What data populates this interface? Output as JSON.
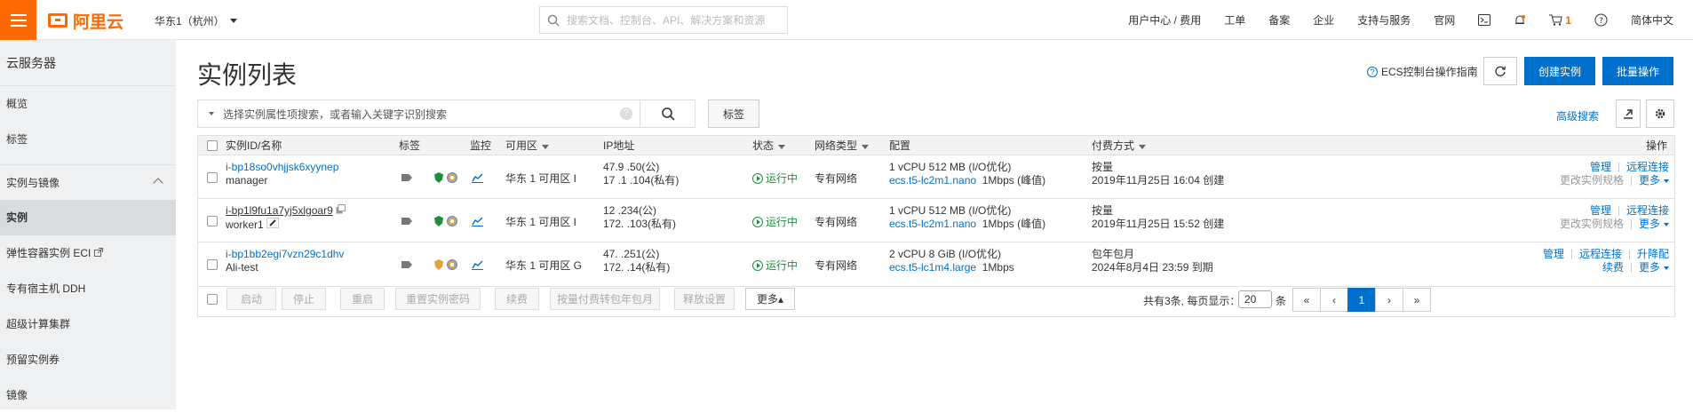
{
  "header": {
    "logo": "阿里云",
    "region": "华东1（杭州）",
    "search_placeholder": "搜索文档、控制台、API、解决方案和资源",
    "nav": [
      "用户中心 / 费用",
      "工单",
      "备案",
      "企业",
      "支持与服务",
      "官网"
    ],
    "cart_count": "1",
    "language": "简体中文"
  },
  "sidebar": {
    "title": "云服务器",
    "items": [
      {
        "label": "概览"
      },
      {
        "label": "标签"
      }
    ],
    "section": "实例与镜像",
    "sub_items": [
      {
        "label": "实例",
        "active": true
      },
      {
        "label": "弹性容器实例 ECI"
      },
      {
        "label": "专有宿主机 DDH"
      },
      {
        "label": "超级计算集群"
      },
      {
        "label": "预留实例券"
      },
      {
        "label": "镜像"
      }
    ]
  },
  "page": {
    "title": "实例列表",
    "guide": "ECS控制台操作指南",
    "create_button": "创建实例",
    "batch_button": "批量操作",
    "filter_placeholder": "选择实例属性项搜索，或者输入关键字识别搜索",
    "tag_button": "标签",
    "advanced_search": "高级搜索"
  },
  "table": {
    "columns": [
      "实例ID/名称",
      "标签",
      "监控",
      "可用区",
      "IP地址",
      "状态",
      "网络类型",
      "配置",
      "付费方式",
      "操作"
    ],
    "rows": [
      {
        "id": "i-bp18so0vhjjsk6xyynep",
        "name": "manager",
        "zone": "华东 1 可用区 I",
        "ip_public": "47.9    .50(公)",
        "ip_private": "17 .1    .104(私有)",
        "status": "运行中",
        "network": "专有网络",
        "config": "1 vCPU 512 MB (I/O优化)",
        "spec": "ecs.t5-lc2m1.nano",
        "bandwidth": "1Mbps (峰值)",
        "billing": "按量",
        "created": "2019年11月25日 16:04 创建",
        "ops_top": [
          "管理",
          "远程连接"
        ],
        "ops_bottom": "更改实例规格",
        "more": "更多"
      },
      {
        "id": "i-bp1l9fu1a7yj5xlgoar9",
        "name": "worker1",
        "zone": "华东 1 可用区 I",
        "ip_public": "12    .234(公)",
        "ip_private": "172.    .103(私有)",
        "status": "运行中",
        "network": "专有网络",
        "config": "1 vCPU 512 MB (I/O优化)",
        "spec": "ecs.t5-lc2m1.nano",
        "bandwidth": "1Mbps (峰值)",
        "billing": "按量",
        "created": "2019年11月25日 15:52 创建",
        "ops_top": [
          "管理",
          "远程连接"
        ],
        "ops_bottom": "更改实例规格",
        "more": "更多"
      },
      {
        "id": "i-bp1bb2egi7vzn29c1dhv",
        "name": "Ali-test",
        "zone": "华东 1 可用区 G",
        "ip_public": "47.    .251(公)",
        "ip_private": "172.    .14(私有)",
        "status": "运行中",
        "network": "专有网络",
        "config": "2 vCPU 8 GiB (I/O优化)",
        "spec": "ecs.t5-lc1m4.large",
        "bandwidth": "1Mbps",
        "billing": "包年包月",
        "created": "2024年8月4日 23:59 到期",
        "ops_top": [
          "管理",
          "远程连接",
          "升降配"
        ],
        "ops_bottom": "续费",
        "more": "更多"
      }
    ]
  },
  "footer": {
    "buttons": [
      "启动",
      "停止",
      "重启",
      "重置实例密码",
      "续费",
      "按量付费转包年包月",
      "释放设置"
    ],
    "more": "更多▴",
    "total": "共有3条, 每页显示：",
    "page_size": "20",
    "unit": "条",
    "pages": [
      "«",
      "‹",
      "1",
      "›",
      "»"
    ]
  }
}
